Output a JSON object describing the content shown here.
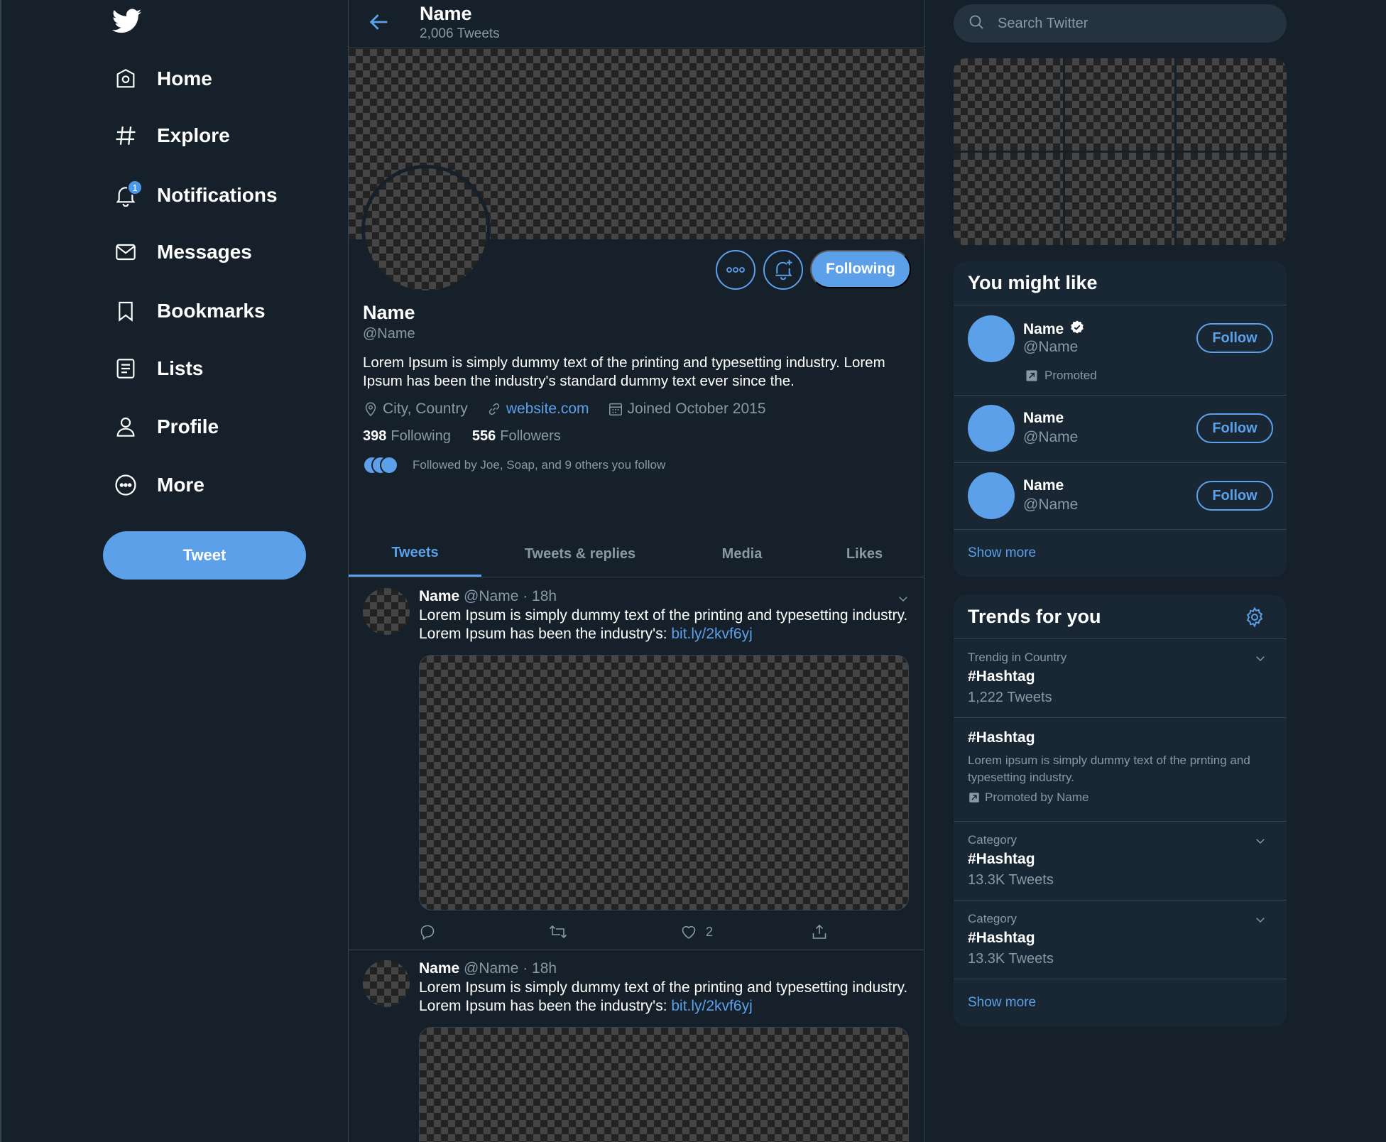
{
  "nav": {
    "items": [
      {
        "label": "Home",
        "icon": "home-icon"
      },
      {
        "label": "Explore",
        "icon": "hashtag-icon"
      },
      {
        "label": "Notifications",
        "icon": "bell-icon",
        "badge": "1"
      },
      {
        "label": "Messages",
        "icon": "envelope-icon"
      },
      {
        "label": "Bookmarks",
        "icon": "bookmark-icon"
      },
      {
        "label": "Lists",
        "icon": "list-icon"
      },
      {
        "label": "Profile",
        "icon": "person-icon"
      },
      {
        "label": "More",
        "icon": "more-circle-icon"
      }
    ],
    "tweet_button": "Tweet"
  },
  "header": {
    "name": "Name",
    "tweet_count": "2,006 Tweets"
  },
  "profile": {
    "name": "Name",
    "handle": "@Name",
    "bio": "Lorem Ipsum is simply dummy text of the printing and typesetting industry. Lorem Ipsum has been the industry's standard dummy text ever since the.",
    "location": "City, Country",
    "website": "website.com",
    "joined": "Joined October 2015",
    "following_count": "398",
    "following_label": "Following",
    "followers_count": "556",
    "followers_label": "Followers",
    "followed_by": "Followed by Joe, Soap, and 9 others you follow",
    "following_button": "Following"
  },
  "tabs": [
    {
      "label": "Tweets",
      "active": true
    },
    {
      "label": "Tweets & replies",
      "active": false
    },
    {
      "label": "Media",
      "active": false
    },
    {
      "label": "Likes",
      "active": false
    }
  ],
  "tweets": [
    {
      "name": "Name",
      "meta": "@Name · 18h",
      "text": "Lorem Ipsum is simply dummy text of the printing and typesetting industry. Lorem Ipsum has been the industry's: ",
      "link": "bit.ly/2kvf6yj",
      "like_count": "2"
    },
    {
      "name": "Name",
      "meta": "@Name · 18h",
      "text": "Lorem Ipsum is simply dummy text of the printing and typesetting industry. Lorem Ipsum has been the industry's: ",
      "link": "bit.ly/2kvf6yj"
    }
  ],
  "search": {
    "placeholder": "Search Twitter"
  },
  "you_might_like": {
    "title": "You might like",
    "items": [
      {
        "name": "Name",
        "handle": "@Name",
        "promoted": "Promoted",
        "verified": true,
        "button": "Follow"
      },
      {
        "name": "Name",
        "handle": "@Name",
        "button": "Follow"
      },
      {
        "name": "Name",
        "handle": "@Name",
        "button": "Follow"
      }
    ],
    "show_more": "Show more"
  },
  "trends": {
    "title": "Trends for you",
    "items": [
      {
        "context": "Trendig in Country",
        "tag": "#Hashtag",
        "count": "1,222 Tweets"
      },
      {
        "tag": "#Hashtag",
        "description": "Lorem ipsum is simply dummy text of the prnting and typesetting industry.",
        "promoted": "Promoted by Name"
      },
      {
        "context": "Category",
        "tag": "#Hashtag",
        "count": "13.3K Tweets"
      },
      {
        "context": "Category",
        "tag": "#Hashtag",
        "count": "13.3K Tweets"
      }
    ],
    "show_more": "Show more"
  },
  "colors": {
    "background": "#15202b",
    "card": "#192734",
    "accent": "#5ba0e8",
    "secondary_text": "#8899a6",
    "border": "#38444d"
  }
}
